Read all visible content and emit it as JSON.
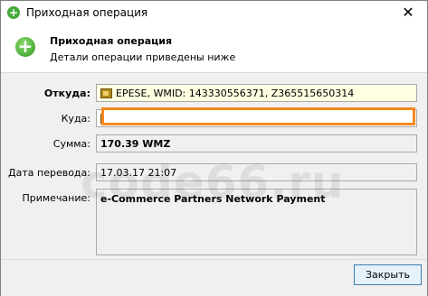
{
  "window": {
    "title": "Приходная операция",
    "close_glyph": "✕"
  },
  "header": {
    "title": "Приходная операция",
    "subtitle": "Детали операции приведены ниже"
  },
  "form": {
    "from_label": "Откуда:",
    "from_value": "EPESE, WMID: 143330556371, Z365515650314",
    "to_label": "Куда:",
    "to_value": "",
    "amount_label": "Сумма:",
    "amount_value": "170.39 WMZ",
    "date_label": "Дата перевода:",
    "date_value": "17.03.17 21:07",
    "note_label": "Примечание:",
    "note_value": "e-Commerce Partners Network Payment"
  },
  "watermark": "code66.ru",
  "buttons": {
    "close_label": "Закрыть"
  },
  "colors": {
    "highlight": "#f7891f",
    "accent_icon": "#45a93a"
  },
  "icons": [
    "add-circle-icon",
    "wallet-icon",
    "close-icon"
  ]
}
